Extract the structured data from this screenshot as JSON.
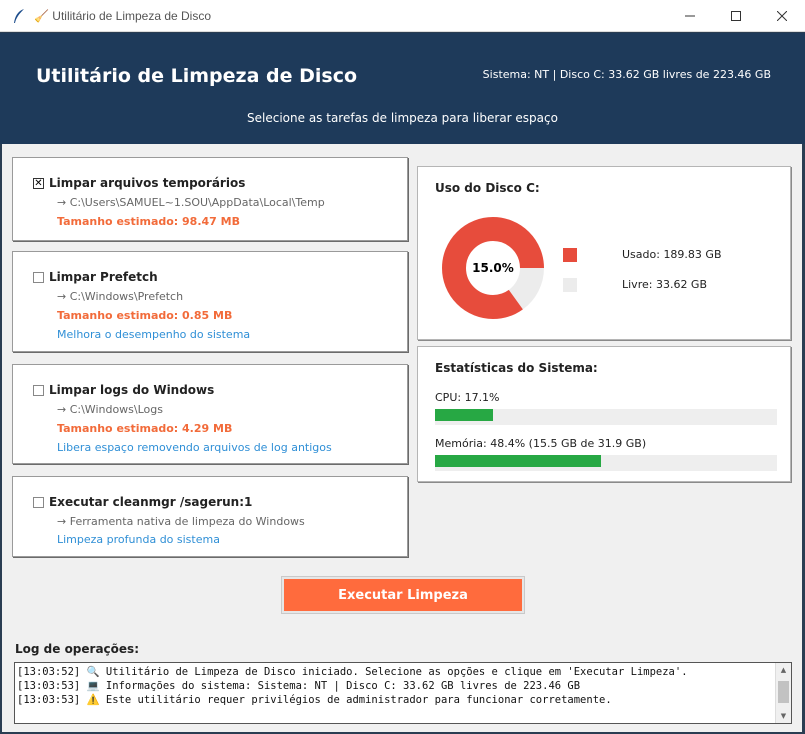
{
  "window": {
    "title": "Utilitário de Limpeza de Disco",
    "title_prefix_icon": "broom-icon"
  },
  "header": {
    "title": "Utilitário de Limpeza de Disco",
    "system_info": "Sistema: NT | Disco C: 33.62 GB livres de 223.46 GB",
    "subtitle": "Selecione as tarefas de limpeza para liberar espaço"
  },
  "tasks": [
    {
      "checked": true,
      "label": "Limpar arquivos temporários",
      "path": "→ C:\\Users\\SAMUEL~1.SOU\\AppData\\Local\\Temp",
      "size": "Tamanho estimado: 98.47 MB",
      "note": ""
    },
    {
      "checked": false,
      "label": "Limpar Prefetch",
      "path": "→ C:\\Windows\\Prefetch",
      "size": "Tamanho estimado: 0.85 MB",
      "note": "Melhora o desempenho do sistema"
    },
    {
      "checked": false,
      "label": "Limpar logs do Windows",
      "path": "→ C:\\Windows\\Logs",
      "size": "Tamanho estimado: 4.29 MB",
      "note": "Libera espaço removendo arquivos de log antigos"
    },
    {
      "checked": false,
      "label": "Executar cleanmgr /sagerun:1",
      "path": "→ Ferramenta nativa de limpeza do Windows",
      "size": "",
      "note": "Limpeza profunda do sistema"
    }
  ],
  "disk": {
    "title": "Uso do Disco C:",
    "free_percent_label": "15.0%",
    "free_fraction": 0.15,
    "used_label": "Usado: 189.83 GB",
    "free_label": "Livre: 33.62 GB",
    "colors": {
      "used": "#e74c3c",
      "free": "#ececec"
    }
  },
  "stats": {
    "title": "Estatísticas do Sistema:",
    "cpu_label": "CPU: 17.1%",
    "cpu_fraction": 0.171,
    "memory_label": "Memória: 48.4% (15.5 GB de 31.9 GB)",
    "memory_fraction": 0.484,
    "bar_color": "#27a844"
  },
  "actions": {
    "execute_label": "Executar Limpeza",
    "accent": "#ff6b3d"
  },
  "log": {
    "title": "Log de operações:",
    "lines": [
      "[13:03:52] 🔍 Utilitário de Limpeza de Disco iniciado. Selecione as opções e clique em 'Executar Limpeza'.",
      "[13:03:53] 💻 Informações do sistema: Sistema: NT | Disco C: 33.62 GB livres de 223.46 GB",
      "[13:03:53] ⚠️ Este utilitário requer privilégios de administrador para funcionar corretamente."
    ]
  }
}
